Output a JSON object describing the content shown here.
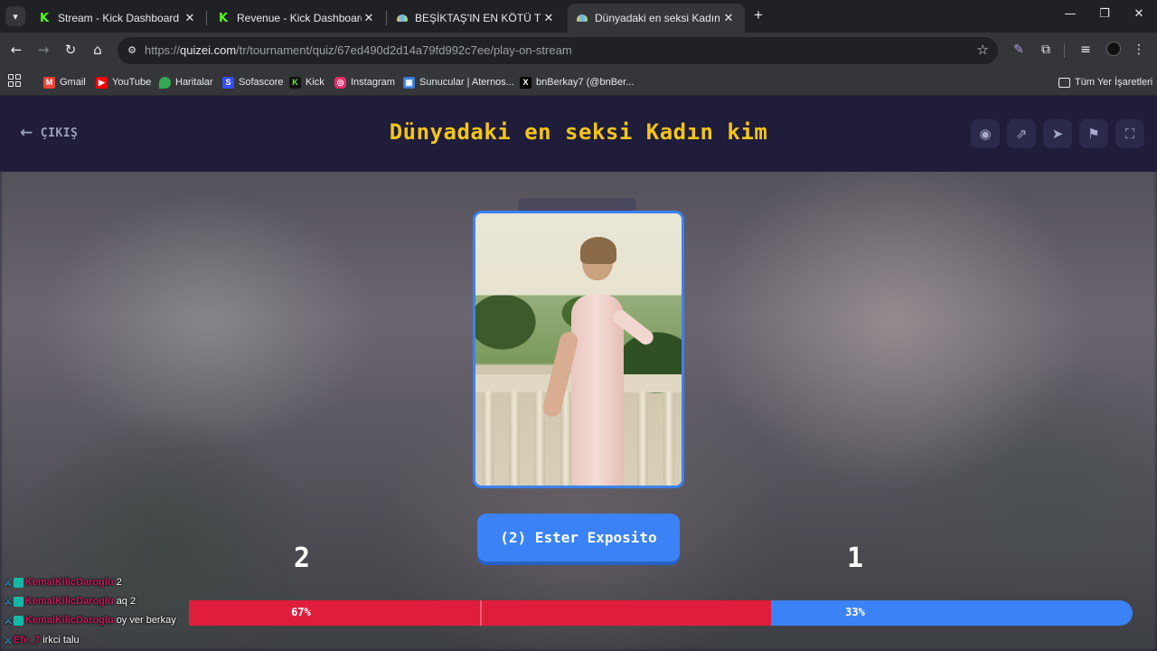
{
  "browser": {
    "tabs": [
      {
        "title": "Stream - Kick Dashboard",
        "favicon": "kick-icon",
        "active": false
      },
      {
        "title": "Revenue - Kick Dashboard",
        "favicon": "kick-icon",
        "active": false
      },
      {
        "title": "BEŞİKTAŞ'IN EN KÖTÜ TRANSFE",
        "favicon": "quizei-icon",
        "active": false
      },
      {
        "title": "Dünyadaki en seksi Kadın kim -",
        "favicon": "quizei-icon",
        "active": true
      }
    ],
    "url_prefix": "https://",
    "url_host": "quizei.com",
    "url_path": "/tr/tournament/quiz/67ed490d2d14a79fd992c7ee/play-on-stream",
    "bookmarks": [
      {
        "label": "Gmail",
        "icon": "gmail-icon",
        "color": "#ea4335"
      },
      {
        "label": "YouTube",
        "icon": "youtube-icon",
        "color": "#ff0000"
      },
      {
        "label": "Haritalar",
        "icon": "maps-icon",
        "color": "#34a853"
      },
      {
        "label": "Sofascore",
        "icon": "sofascore-icon",
        "color": "#374df5"
      },
      {
        "label": "Kick",
        "icon": "kick-icon",
        "color": "#53fc18"
      },
      {
        "label": "Instagram",
        "icon": "instagram-icon",
        "color": "#e1306c"
      },
      {
        "label": "Sunucular | Aternos...",
        "icon": "aternos-icon",
        "color": "#3b7dd8"
      },
      {
        "label": "bnBerkay7 (@bnBer...",
        "icon": "x-icon",
        "color": "#000000"
      }
    ],
    "all_bookmarks_label": "Tüm Yer İşaretleri"
  },
  "quiz": {
    "exit_label": "ÇIKIŞ",
    "title": "Dünyadaki en seksi Kadın kim",
    "choice_label": "(2) Ester Exposito",
    "left_number": "2",
    "right_number": "1",
    "left_percent_label": "67%",
    "right_percent_label": "33%",
    "left_share": 0.67,
    "right_share": 0.33,
    "colors": {
      "accent_yellow": "#f5c518",
      "vote_red": "#e11d3c",
      "vote_blue": "#3b82f6",
      "header_bg": "#1f1d3a"
    }
  },
  "chat": [
    {
      "user": "KemalKilicDaroglu",
      "msg": "2"
    },
    {
      "user": "KemalKilicDaroglu",
      "msg": "aq 2"
    },
    {
      "user": "KemalKilicDaroglu",
      "msg": "oy ver berkay"
    },
    {
      "user": "Efe_7",
      "msg": "irkci talu"
    }
  ]
}
